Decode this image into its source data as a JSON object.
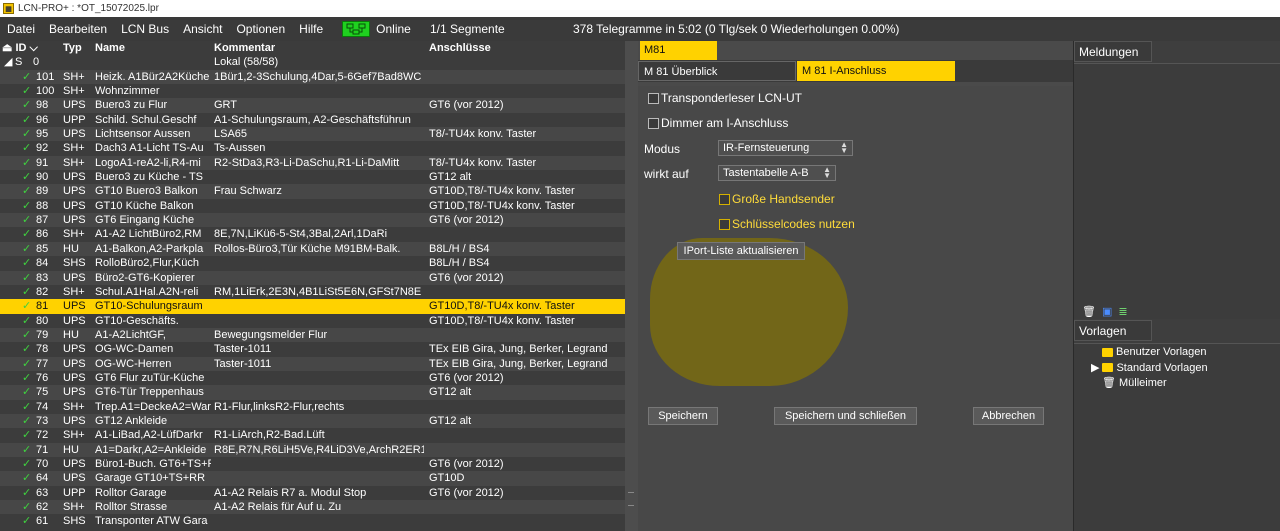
{
  "window": {
    "title": "LCN-PRO+ : *OT_15072025.lpr"
  },
  "menu": [
    "Datei",
    "Bearbeiten",
    "LCN Bus",
    "Ansicht",
    "Optionen",
    "Hilfe"
  ],
  "status": {
    "online": "Online",
    "segments": "1/1 Segmente",
    "telegrams": "378 Telegramme in 5:02 (0 Tlg/sek  0 Wiederholungen 0.00%)"
  },
  "tree": {
    "headers": {
      "id": "ID",
      "typ": "Typ",
      "name": "Name",
      "kommentar": "Kommentar",
      "anschluesse": "Anschlüsse"
    },
    "segment": {
      "id": "S",
      "value": "0",
      "label": "Lokal (58/58)"
    },
    "rows": [
      {
        "id": "101",
        "typ": "SH+",
        "name": "Heizk. A1Bür2A2Küche",
        "kommentar": "1Bür1,2-3Schulung,4Dar,5-6Gef7Bad8WC",
        "ansch": "",
        "wide": true
      },
      {
        "id": "100",
        "typ": "SH+",
        "name": "Wohnzimmer",
        "kommentar": "",
        "ansch": ""
      },
      {
        "id": "98",
        "typ": "UPS",
        "name": "Buero3 zu Flur",
        "kommentar": "GRT",
        "ansch": "GT6 (vor 2012)"
      },
      {
        "id": "96",
        "typ": "UPP",
        "name": "Schild. Schul.Geschf",
        "kommentar": "A1-Schulungsraum, A2-Geschäftsführun",
        "ansch": ""
      },
      {
        "id": "95",
        "typ": "UPS",
        "name": "Lichtsensor Aussen",
        "kommentar": "LSA65",
        "ansch": "T8/-TU4x konv. Taster"
      },
      {
        "id": "92",
        "typ": "SH+",
        "name": "Dach3 A1-Licht TS-Au",
        "kommentar": "Ts-Aussen",
        "ansch": ""
      },
      {
        "id": "91",
        "typ": "SH+",
        "name": "LogoA1-reA2-li,R4-mi",
        "kommentar": "R2-StDa3,R3-Li-DaSchu,R1-Li-DaMitt",
        "ansch": "T8/-TU4x konv. Taster"
      },
      {
        "id": "90",
        "typ": "UPS",
        "name": "Buero3 zu Küche - TS",
        "kommentar": "",
        "ansch": "GT12 alt"
      },
      {
        "id": "89",
        "typ": "UPS",
        "name": "GT10 Buero3 Balkon",
        "kommentar": "Frau Schwarz",
        "ansch": "GT10D,T8/-TU4x konv. Taster"
      },
      {
        "id": "88",
        "typ": "UPS",
        "name": "GT10 Küche Balkon",
        "kommentar": "",
        "ansch": "GT10D,T8/-TU4x konv. Taster"
      },
      {
        "id": "87",
        "typ": "UPS",
        "name": "GT6 Eingang Küche",
        "kommentar": "",
        "ansch": "GT6 (vor 2012)"
      },
      {
        "id": "86",
        "typ": "SH+",
        "name": "A1-A2 LichtBüro2,RM",
        "kommentar": "8E,7N,LiKü6-5-St4,3Bal,2Arl,1DaRi",
        "ansch": ""
      },
      {
        "id": "85",
        "typ": "HU",
        "name": "A1-Balkon,A2-Parkpla",
        "kommentar": "Rollos-Büro3,Tür Küche M91BM-Balk.",
        "ansch": "B8L/H / BS4"
      },
      {
        "id": "84",
        "typ": "SHS",
        "name": "RolloBüro2,Flur,Küch",
        "kommentar": "",
        "ansch": "B8L/H / BS4"
      },
      {
        "id": "83",
        "typ": "UPS",
        "name": "Büro2-GT6-Kopierer",
        "kommentar": "",
        "ansch": "GT6 (vor 2012)"
      },
      {
        "id": "82",
        "typ": "SH+",
        "name": "Schul.A1Hal.A2N-reli",
        "kommentar": "RM,1LiErk,2E3N,4B1LiSt5E6N,GFSt7N8E",
        "ansch": ""
      },
      {
        "id": "81",
        "typ": "UPS",
        "name": "GT10-Schulungsraum",
        "kommentar": "",
        "ansch": "GT10D,T8/-TU4x konv. Taster",
        "selected": true
      },
      {
        "id": "80",
        "typ": "UPS",
        "name": "GT10-Geschäfts.",
        "kommentar": "",
        "ansch": "GT10D,T8/-TU4x konv. Taster"
      },
      {
        "id": "79",
        "typ": "HU",
        "name": "A1-A2LichtGF,",
        "kommentar": "Bewegungsmelder Flur",
        "ansch": ""
      },
      {
        "id": "78",
        "typ": "UPS",
        "name": "OG-WC-Damen",
        "kommentar": "Taster-1011",
        "ansch": "TEx EIB Gira, Jung, Berker, Legrand"
      },
      {
        "id": "77",
        "typ": "UPS",
        "name": "OG-WC-Herren",
        "kommentar": "Taster-1011",
        "ansch": "TEx EIB Gira, Jung, Berker, Legrand"
      },
      {
        "id": "76",
        "typ": "UPS",
        "name": "GT6 Flur zuTür-Küche",
        "kommentar": "",
        "ansch": "GT6 (vor 2012)"
      },
      {
        "id": "75",
        "typ": "UPS",
        "name": "GT6-Tür Treppenhaus",
        "kommentar": "",
        "ansch": "GT12 alt"
      },
      {
        "id": "74",
        "typ": "SH+",
        "name": "Trep.A1=DeckeA2=War",
        "kommentar": "R1-Flur,linksR2-Flur,rechts",
        "ansch": ""
      },
      {
        "id": "73",
        "typ": "UPS",
        "name": "GT12 Ankleide",
        "kommentar": "",
        "ansch": "GT12 alt"
      },
      {
        "id": "72",
        "typ": "SH+",
        "name": "A1-LiBad,A2-LüfDarkr",
        "kommentar": "R1-LiArch,R2-Bad.Lüft",
        "ansch": ""
      },
      {
        "id": "71",
        "typ": "HU",
        "name": "A1=Darkr,A2=Ankleide",
        "kommentar": "R8E,R7N,R6LiH5Ve,R4LiD3Ve,ArchR2ER1",
        "ansch": ""
      },
      {
        "id": "70",
        "typ": "UPS",
        "name": "Büro1-Buch. GT6+TS+F",
        "kommentar": "",
        "ansch": "GT6 (vor 2012)"
      },
      {
        "id": "64",
        "typ": "UPS",
        "name": "Garage GT10+TS+RR",
        "kommentar": "",
        "ansch": "GT10D"
      },
      {
        "id": "63",
        "typ": "UPP",
        "name": "Rolltor Garage",
        "kommentar": "A1-A2 Relais R7 a. Modul Stop",
        "ansch": "GT6 (vor 2012)"
      },
      {
        "id": "62",
        "typ": "SH+",
        "name": "Rolltor Strasse",
        "kommentar": "A1-A2 Relais für Auf u. Zu",
        "ansch": ""
      },
      {
        "id": "61",
        "typ": "SHS",
        "name": "Transponter ATW Gara",
        "kommentar": "",
        "ansch": ""
      }
    ]
  },
  "module": {
    "tab": "M81",
    "subtabs": [
      "M 81 Überblick",
      "M 81 I-Anschluss"
    ],
    "transponder_label": "Transponderleser LCN-UT",
    "dimmer_label": "Dimmer am I-Anschluss",
    "modus_label": "Modus",
    "modus_value": "IR-Fernsteuerung",
    "wirkt_label": "wirkt auf",
    "wirkt_value": "Tastentabelle A-B",
    "grosse_label": "Große Handsender",
    "schluessel_label": "Schlüsselcodes nutzen",
    "iport_button": "IPort-Liste aktualisieren",
    "save_button": "Speichern",
    "save_close_button": "Speichern und schließen",
    "cancel_button": "Abbrechen"
  },
  "right": {
    "messages_tab": "Meldungen",
    "templates_tab": "Vorlagen",
    "templates": [
      "Benutzer Vorlagen",
      "Standard Vorlagen",
      "Mülleimer"
    ]
  }
}
